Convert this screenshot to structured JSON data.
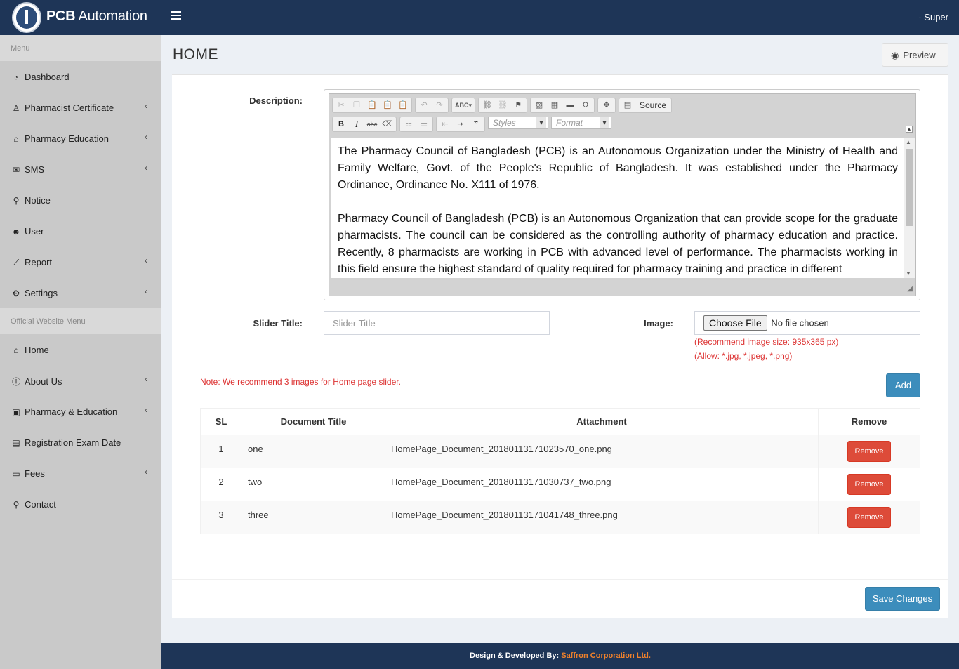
{
  "header": {
    "brand_bold": "PCB",
    "brand_light": " Automation",
    "user": "- Super"
  },
  "sidebar": {
    "menu_heading": "Menu",
    "menu": [
      {
        "label": "Dashboard",
        "icon": "dashboard-icon",
        "glyph": "◔",
        "submenu": false
      },
      {
        "label": "Pharmacist Certificate",
        "icon": "certificate-icon",
        "glyph": "♙",
        "submenu": true
      },
      {
        "label": "Pharmacy Education",
        "icon": "institution-icon",
        "glyph": "⌂",
        "submenu": true
      },
      {
        "label": "SMS",
        "icon": "envelope-icon",
        "glyph": "✉",
        "submenu": true
      },
      {
        "label": "Notice",
        "icon": "pin-icon",
        "glyph": "⚲",
        "submenu": false
      },
      {
        "label": "User",
        "icon": "users-icon",
        "glyph": "☻",
        "submenu": false
      },
      {
        "label": "Report",
        "icon": "line-chart-icon",
        "glyph": "⟋",
        "submenu": true
      },
      {
        "label": "Settings",
        "icon": "cogs-icon",
        "glyph": "⚙",
        "submenu": true
      }
    ],
    "website_heading": "Official Website Menu",
    "website_menu": [
      {
        "label": "Home",
        "icon": "home-icon",
        "glyph": "⌂",
        "submenu": false
      },
      {
        "label": "About Us",
        "icon": "info-circle-icon",
        "glyph": "ⓘ",
        "submenu": true
      },
      {
        "label": "Pharmacy & Education",
        "icon": "briefcase-icon",
        "glyph": "▣",
        "submenu": true
      },
      {
        "label": "Registration Exam Date",
        "icon": "file-icon",
        "glyph": "▤",
        "submenu": false
      },
      {
        "label": "Fees",
        "icon": "money-icon",
        "glyph": "▭",
        "submenu": true
      },
      {
        "label": "Contact",
        "icon": "map-marker-icon",
        "glyph": "⚲",
        "submenu": false
      }
    ]
  },
  "page": {
    "title": "HOME",
    "preview_label": "Preview"
  },
  "form": {
    "description_label": "Description:",
    "editor": {
      "source_label": "Source",
      "styles_placeholder": "Styles",
      "format_placeholder": "Format",
      "paragraphs": [
        "The Pharmacy Council of Bangladesh (PCB) is an Autonomous Organization under the Ministry of Health and Family Welfare, Govt. of the People's Republic of Bangladesh. It was established under the Pharmacy Ordinance, Ordinance No. X111 of 1976.",
        "Pharmacy Council of Bangladesh (PCB) is an Autonomous Organization that can provide scope for the graduate pharmacists. The council can be considered as the controlling authority of pharmacy education and practice. Recently, 8 pharmacists are working in PCB with advanced level of performance. The pharmacists working in this field ensure the highest standard of quality required for pharmacy training and practice in different"
      ]
    },
    "slider_title_label": "Slider Title:",
    "slider_title_placeholder": "Slider Title",
    "image_label": "Image:",
    "file_button": "Choose File",
    "file_status": "No file chosen",
    "hint_size": "(Recommend image size: 935x365 px)",
    "hint_allow": "(Allow: *.jpg, *.jpeg, *.png)",
    "note": "Note: We recommend 3 images for Home page slider.",
    "add_label": "Add",
    "save_label": "Save Changes"
  },
  "table": {
    "headers": [
      "SL",
      "Document Title",
      "Attachment",
      "Remove"
    ],
    "remove_label": "Remove",
    "rows": [
      {
        "sl": "1",
        "title": "one",
        "attachment": "HomePage_Document_20180113171023570_one.png"
      },
      {
        "sl": "2",
        "title": "two",
        "attachment": "HomePage_Document_20180113171030737_two.png"
      },
      {
        "sl": "3",
        "title": "three",
        "attachment": "HomePage_Document_20180113171041748_three.png"
      }
    ]
  },
  "footer": {
    "prefix": "Design & Developed By: ",
    "company": "Saffron Corporation Ltd."
  },
  "colors": {
    "header_bg": "#1e3557",
    "sidebar_bg": "#c9c9c9",
    "primary": "#3c8dbc",
    "danger": "#dd4b39",
    "note_red": "#dd3333",
    "footer_accent": "#f0812b"
  }
}
